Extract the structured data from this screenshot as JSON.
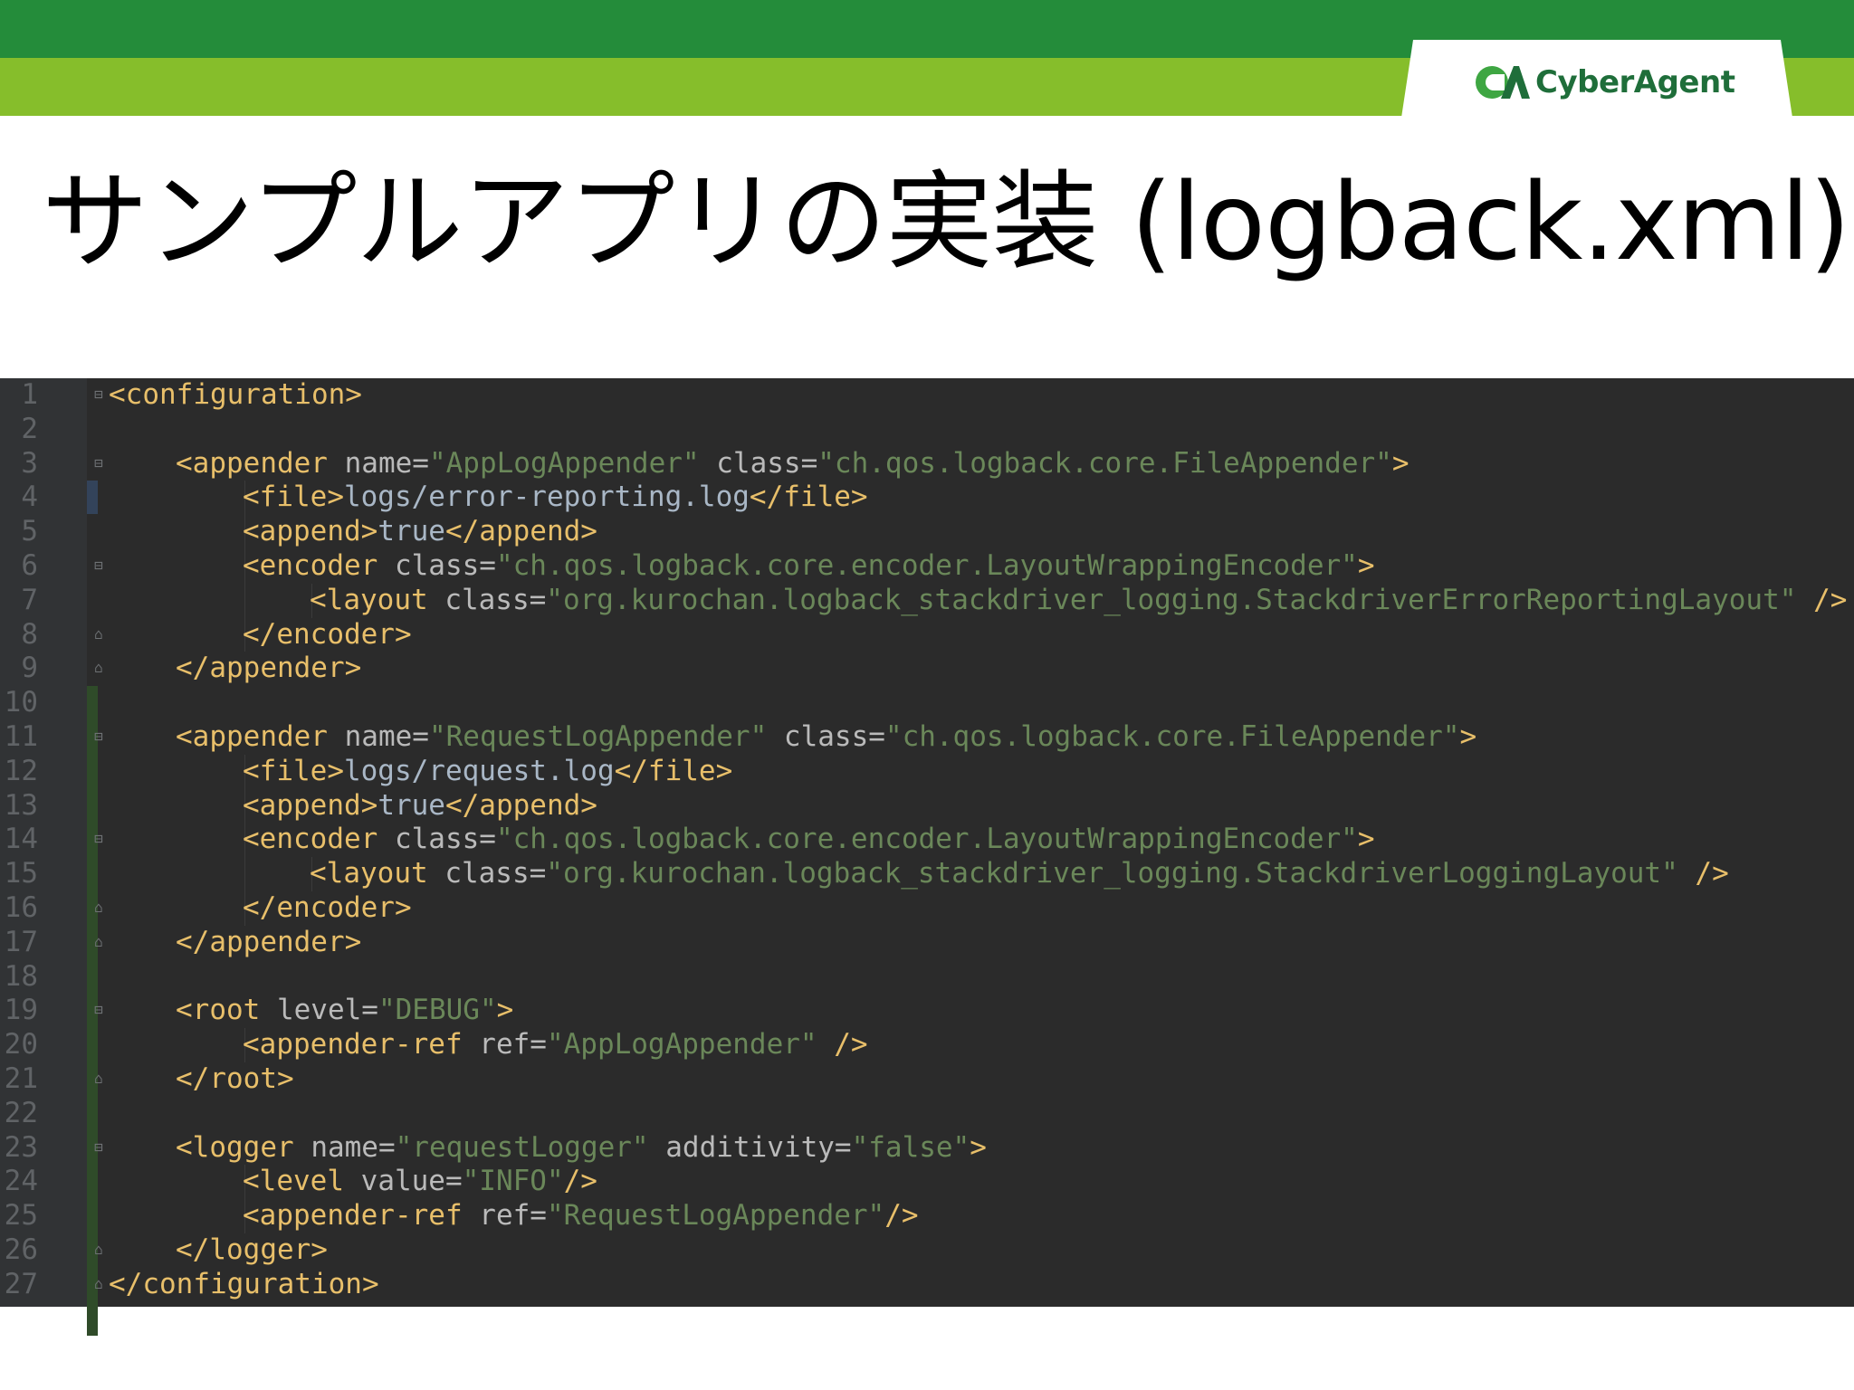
{
  "header": {
    "logo_text": "CyberAgent",
    "colors": {
      "band_dark": "#248c3a",
      "band_light": "#86be2b",
      "logo_green": "#1f6e3a"
    }
  },
  "slide": {
    "title": "サンプルアプリの実装 (logback.xml)"
  },
  "editor": {
    "colors": {
      "background": "#2b2b2b",
      "tag": "#e8bf6a",
      "attribute": "#bababa",
      "value": "#6a8759",
      "text": "#a9b7c6",
      "line_number": "#606366"
    },
    "lines": [
      {
        "number": "1",
        "indent": 0,
        "tokens": [
          [
            "tag",
            "<configuration>"
          ]
        ],
        "fold": "open"
      },
      {
        "number": "2",
        "indent": 0,
        "tokens": [],
        "fold": ""
      },
      {
        "number": "3",
        "indent": 1,
        "tokens": [
          [
            "tag",
            "<appender "
          ],
          [
            "attr",
            "name="
          ],
          [
            "val",
            "\"AppLogAppender\""
          ],
          [
            "attr",
            " class="
          ],
          [
            "val",
            "\"ch.qos.logback.core.FileAppender\""
          ],
          [
            "tag",
            ">"
          ]
        ],
        "fold": "open"
      },
      {
        "number": "4",
        "indent": 2,
        "tokens": [
          [
            "tag",
            "<file>"
          ],
          [
            "txt",
            "logs/error-reporting.log"
          ],
          [
            "tag",
            "</file>"
          ]
        ],
        "fold": ""
      },
      {
        "number": "5",
        "indent": 2,
        "tokens": [
          [
            "tag",
            "<append>"
          ],
          [
            "txt",
            "true"
          ],
          [
            "tag",
            "</append>"
          ]
        ],
        "fold": ""
      },
      {
        "number": "6",
        "indent": 2,
        "tokens": [
          [
            "tag",
            "<encoder "
          ],
          [
            "attr",
            "class="
          ],
          [
            "val",
            "\"ch.qos.logback.core.encoder.LayoutWrappingEncoder\""
          ],
          [
            "tag",
            ">"
          ]
        ],
        "fold": "open"
      },
      {
        "number": "7",
        "indent": 3,
        "tokens": [
          [
            "tag",
            "<layout "
          ],
          [
            "attr",
            "class="
          ],
          [
            "val",
            "\"org.kurochan.logback_stackdriver_logging.StackdriverErrorReportingLayout\""
          ],
          [
            "tag",
            " />"
          ]
        ],
        "fold": ""
      },
      {
        "number": "8",
        "indent": 2,
        "tokens": [
          [
            "tag",
            "</encoder>"
          ]
        ],
        "fold": "close"
      },
      {
        "number": "9",
        "indent": 1,
        "tokens": [
          [
            "tag",
            "</appender>"
          ]
        ],
        "fold": "close"
      },
      {
        "number": "10",
        "indent": 0,
        "tokens": [],
        "fold": ""
      },
      {
        "number": "11",
        "indent": 1,
        "tokens": [
          [
            "tag",
            "<appender "
          ],
          [
            "attr",
            "name="
          ],
          [
            "val",
            "\"RequestLogAppender\""
          ],
          [
            "attr",
            " class="
          ],
          [
            "val",
            "\"ch.qos.logback.core.FileAppender\""
          ],
          [
            "tag",
            ">"
          ]
        ],
        "fold": "open"
      },
      {
        "number": "12",
        "indent": 2,
        "tokens": [
          [
            "tag",
            "<file>"
          ],
          [
            "txt",
            "logs/request.log"
          ],
          [
            "tag",
            "</file>"
          ]
        ],
        "fold": ""
      },
      {
        "number": "13",
        "indent": 2,
        "tokens": [
          [
            "tag",
            "<append>"
          ],
          [
            "txt",
            "true"
          ],
          [
            "tag",
            "</append>"
          ]
        ],
        "fold": ""
      },
      {
        "number": "14",
        "indent": 2,
        "tokens": [
          [
            "tag",
            "<encoder "
          ],
          [
            "attr",
            "class="
          ],
          [
            "val",
            "\"ch.qos.logback.core.encoder.LayoutWrappingEncoder\""
          ],
          [
            "tag",
            ">"
          ]
        ],
        "fold": "open"
      },
      {
        "number": "15",
        "indent": 3,
        "tokens": [
          [
            "tag",
            "<layout "
          ],
          [
            "attr",
            "class="
          ],
          [
            "val",
            "\"org.kurochan.logback_stackdriver_logging.StackdriverLoggingLayout\""
          ],
          [
            "tag",
            " />"
          ]
        ],
        "fold": ""
      },
      {
        "number": "16",
        "indent": 2,
        "tokens": [
          [
            "tag",
            "</encoder>"
          ]
        ],
        "fold": "close"
      },
      {
        "number": "17",
        "indent": 1,
        "tokens": [
          [
            "tag",
            "</appender>"
          ]
        ],
        "fold": "close"
      },
      {
        "number": "18",
        "indent": 0,
        "tokens": [],
        "fold": ""
      },
      {
        "number": "19",
        "indent": 1,
        "tokens": [
          [
            "tag",
            "<root "
          ],
          [
            "attr",
            "level="
          ],
          [
            "val",
            "\"DEBUG\""
          ],
          [
            "tag",
            ">"
          ]
        ],
        "fold": "open"
      },
      {
        "number": "20",
        "indent": 2,
        "tokens": [
          [
            "tag",
            "<appender-ref "
          ],
          [
            "attr",
            "ref="
          ],
          [
            "val",
            "\"AppLogAppender\""
          ],
          [
            "tag",
            " />"
          ]
        ],
        "fold": ""
      },
      {
        "number": "21",
        "indent": 1,
        "tokens": [
          [
            "tag",
            "</root>"
          ]
        ],
        "fold": "close"
      },
      {
        "number": "22",
        "indent": 0,
        "tokens": [],
        "fold": ""
      },
      {
        "number": "23",
        "indent": 1,
        "tokens": [
          [
            "tag",
            "<logger "
          ],
          [
            "attr",
            "name="
          ],
          [
            "val",
            "\"requestLogger\""
          ],
          [
            "attr",
            " additivity="
          ],
          [
            "val",
            "\"false\""
          ],
          [
            "tag",
            ">"
          ]
        ],
        "fold": "open"
      },
      {
        "number": "24",
        "indent": 2,
        "tokens": [
          [
            "tag",
            "<level "
          ],
          [
            "attr",
            "value="
          ],
          [
            "val",
            "\"INFO\""
          ],
          [
            "tag",
            "/>"
          ]
        ],
        "fold": ""
      },
      {
        "number": "25",
        "indent": 2,
        "tokens": [
          [
            "tag",
            "<appender-ref "
          ],
          [
            "attr",
            "ref="
          ],
          [
            "val",
            "\"RequestLogAppender\""
          ],
          [
            "tag",
            "/>"
          ]
        ],
        "fold": ""
      },
      {
        "number": "26",
        "indent": 1,
        "tokens": [
          [
            "tag",
            "</logger>"
          ]
        ],
        "fold": "close"
      },
      {
        "number": "27",
        "indent": 0,
        "tokens": [
          [
            "tag",
            "</configuration>"
          ]
        ],
        "fold": "close"
      }
    ]
  }
}
